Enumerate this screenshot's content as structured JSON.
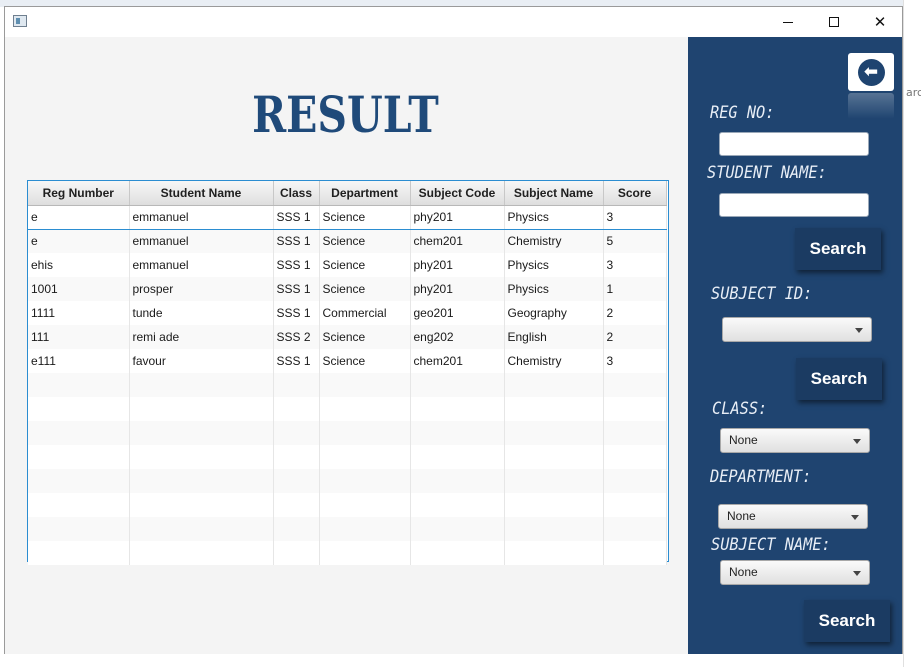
{
  "desktop": {
    "side_text": "arc"
  },
  "window": {
    "controls": {
      "minimize": "minimize",
      "maximize": "maximize",
      "close": "close"
    }
  },
  "page_title": "RESULT",
  "table": {
    "columns": [
      "Reg Number",
      "Student Name",
      "Class",
      "Department",
      "Subject Code",
      "Subject Name",
      "Score"
    ],
    "rows": [
      [
        "e",
        "emmanuel",
        "SSS 1",
        "Science",
        "phy201",
        "Physics",
        "3"
      ],
      [
        "e",
        "emmanuel",
        "SSS 1",
        "Science",
        "chem201",
        "Chemistry",
        "5"
      ],
      [
        "ehis",
        "emmanuel",
        "SSS 1",
        "Science",
        "phy201",
        "Physics",
        "3"
      ],
      [
        "1001",
        "prosper",
        "SSS 1",
        "Science",
        "phy201",
        "Physics",
        "1"
      ],
      [
        "1111",
        "tunde",
        "SSS 1",
        "Commercial",
        "geo201",
        "Geography",
        "2"
      ],
      [
        "111",
        "remi ade",
        "SSS 2",
        "Science",
        "eng202",
        "English",
        "2"
      ],
      [
        "e111",
        "favour",
        "SSS 1",
        "Science",
        "chem201",
        "Chemistry",
        "3"
      ]
    ],
    "empty_rows": 8
  },
  "sidebar": {
    "back_icon": "arrow-left-circle-icon",
    "reg_no_label": "REG NO:",
    "reg_no_value": "",
    "student_name_label": "STUDENT NAME:",
    "student_name_value": "",
    "search1_label": "Search",
    "subject_id_label": "SUBJECT ID:",
    "subject_id_value": "",
    "search2_label": "Search",
    "class_label": "CLASS:",
    "class_value": "None",
    "department_label": "DEPARTMENT:",
    "department_value": "None",
    "subject_name_label": "SUBJECT NAME:",
    "subject_name_value": "None",
    "search3_label": "Search"
  },
  "colors": {
    "accent": "#1f4470",
    "title": "#1f4a7a",
    "selection": "#2b8dd1"
  }
}
